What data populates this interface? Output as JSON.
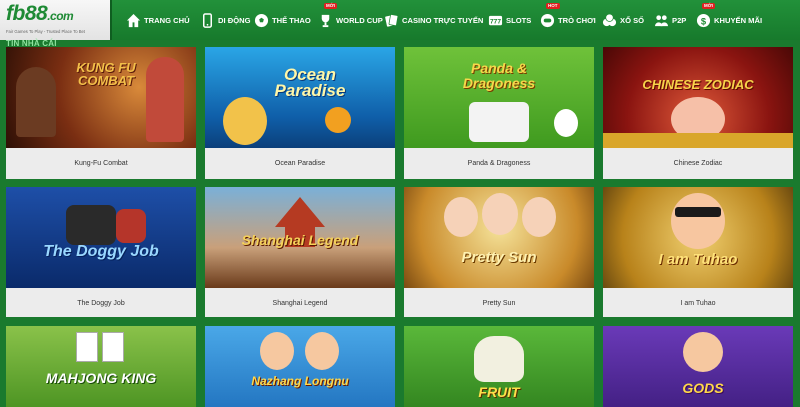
{
  "logo": {
    "main": "fb88",
    "suffix": ".com",
    "tagline": "Fair Games To Play - Trusted Place To Bet"
  },
  "nav": {
    "items": [
      {
        "label": "TRANG CHỦ",
        "icon": "home-icon",
        "badge": ""
      },
      {
        "label": "DI ĐỘNG",
        "icon": "mobile-icon",
        "badge": ""
      },
      {
        "label": "THỂ THAO",
        "icon": "soccer-ball-icon",
        "badge": ""
      },
      {
        "label": "WORLD CUP",
        "icon": "world-cup-icon",
        "badge": "MỚI"
      },
      {
        "label": "CASINO TRỰC TUYẾN",
        "icon": "cards-icon",
        "badge": ""
      },
      {
        "label": "SLOTS",
        "icon": "slot-777-icon",
        "badge": ""
      },
      {
        "label": "TRÒ CHƠI",
        "icon": "game-controller-icon",
        "badge": "HOT"
      },
      {
        "label": "XỔ SỐ",
        "icon": "lottery-balls-icon",
        "badge": ""
      },
      {
        "label": "P2P",
        "icon": "p2p-users-icon",
        "badge": ""
      },
      {
        "label": "KHUYẾN MÃI",
        "icon": "dollar-coin-icon",
        "badge": "MỚI"
      }
    ]
  },
  "section": {
    "title": "TIN NHÀ CÁI"
  },
  "games": [
    {
      "name": "Kung-Fu Combat",
      "art": "KUNG FU COMBAT"
    },
    {
      "name": "Ocean Paradise",
      "art": "Ocean Paradise"
    },
    {
      "name": "Panda & Dragoness",
      "art": "Panda & Dragoness"
    },
    {
      "name": "Chinese Zodiac",
      "art": "CHINESE ZODIAC"
    },
    {
      "name": "The Doggy Job",
      "art": "The Doggy Job"
    },
    {
      "name": "Shanghai Legend",
      "art": "Shanghai Legend"
    },
    {
      "name": "Pretty Sun",
      "art": "Pretty Sun"
    },
    {
      "name": "I am Tuhao",
      "art": "I am Tuhao"
    },
    {
      "name": "",
      "art": "MAHJONG KING"
    },
    {
      "name": "",
      "art": "Nazhang Longnu"
    },
    {
      "name": "",
      "art": "FRUIT"
    },
    {
      "name": "",
      "art": "GODS"
    }
  ],
  "colors": {
    "header": "#1e8a34",
    "page": "#1a7a2e",
    "caption": "#ececec"
  }
}
